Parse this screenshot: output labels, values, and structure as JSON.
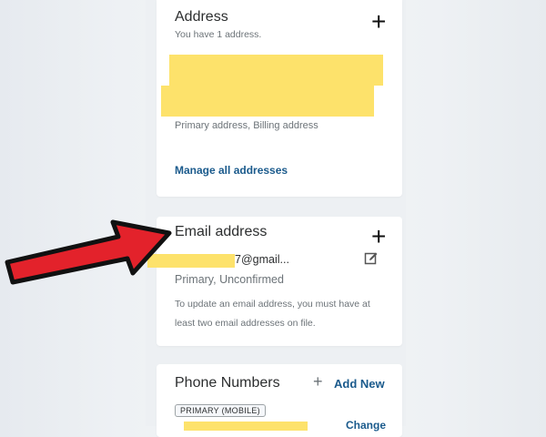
{
  "address": {
    "title": "Address",
    "count_text": "You have 1 address.",
    "type_text": "Primary address, Billing address",
    "manage_link": "Manage all addresses"
  },
  "email": {
    "title": "Email address",
    "email_partial": "7@gmail...",
    "status": "Primary, Unconfirmed",
    "note_line1": "To update an email address, you must have at",
    "note_line2": "least two email addresses on file."
  },
  "phone": {
    "title": "Phone Numbers",
    "add_new": "Add New",
    "badge": "PRIMARY (MOBILE)",
    "change": "Change"
  },
  "colors": {
    "redaction": "#fde26b",
    "link": "#1a5a8c",
    "arrow_fill": "#e3222b"
  },
  "icons": [
    "plus-icon",
    "edit-pencil-icon",
    "red-arrow-annotation"
  ]
}
